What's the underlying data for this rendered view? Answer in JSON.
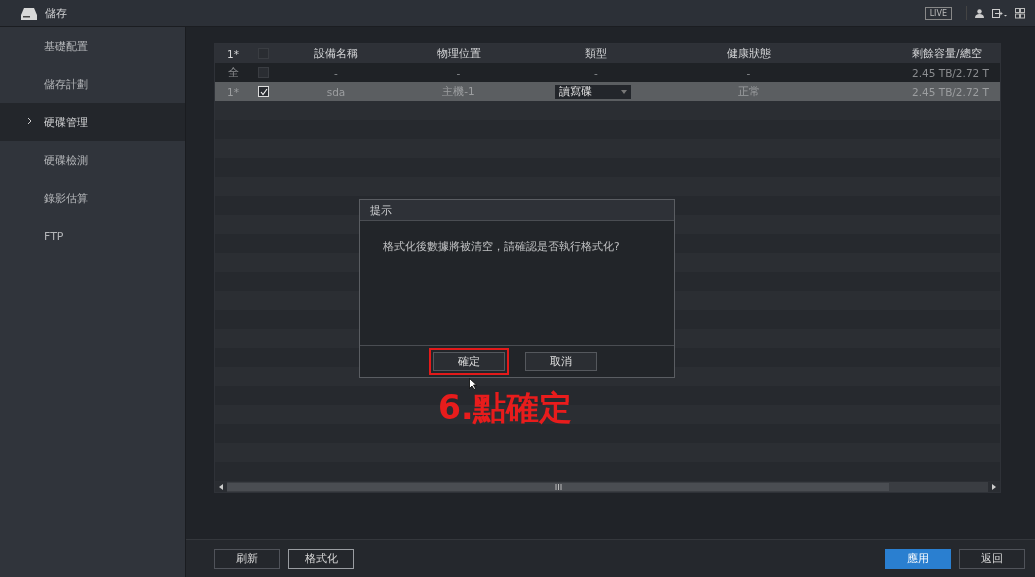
{
  "title_bar": {
    "title": "儲存",
    "live_label": "LIVE"
  },
  "sidebar": {
    "items": [
      {
        "label": "基礎配置",
        "selected": false
      },
      {
        "label": "儲存計劃",
        "selected": false
      },
      {
        "label": "硬碟管理",
        "selected": true
      },
      {
        "label": "硬碟檢測",
        "selected": false
      },
      {
        "label": "錄影估算",
        "selected": false
      },
      {
        "label": "FTP",
        "selected": false
      }
    ]
  },
  "table": {
    "header": {
      "index": "1*",
      "checked": false,
      "columns": [
        "設備名稱",
        "物理位置",
        "類型",
        "健康狀態",
        "剩餘容量/總空"
      ]
    },
    "rows": [
      {
        "index": "全",
        "checked": false,
        "selected": false,
        "cells": [
          {
            "kind": "text",
            "text": "-"
          },
          {
            "kind": "text",
            "text": "-"
          },
          {
            "kind": "text",
            "text": "-"
          },
          {
            "kind": "text",
            "text": "-"
          },
          {
            "kind": "text",
            "text": "2.45 TB/2.72 T"
          }
        ]
      },
      {
        "index": "1*",
        "checked": true,
        "selected": true,
        "cells": [
          {
            "kind": "text",
            "text": "sda"
          },
          {
            "kind": "text",
            "text": "主機-1"
          },
          {
            "kind": "dropdown",
            "text": "讀寫碟"
          },
          {
            "kind": "text",
            "text": "正常"
          },
          {
            "kind": "text",
            "text": "2.45 TB/2.72 T"
          }
        ]
      }
    ]
  },
  "dialog": {
    "title": "提示",
    "message": "格式化後數據將被清空，請確認是否執行格式化?",
    "buttons": [
      {
        "label": "確定",
        "highlighted": true
      },
      {
        "label": "取消",
        "highlighted": false
      }
    ]
  },
  "annotation": {
    "text": "6.點確定"
  },
  "footer": {
    "left_buttons": [
      {
        "label": "刷新",
        "kind": "normal"
      },
      {
        "label": "格式化",
        "kind": "focused"
      }
    ],
    "right_buttons": [
      {
        "label": "應用",
        "kind": "primary"
      },
      {
        "label": "返回",
        "kind": "normal"
      }
    ]
  }
}
